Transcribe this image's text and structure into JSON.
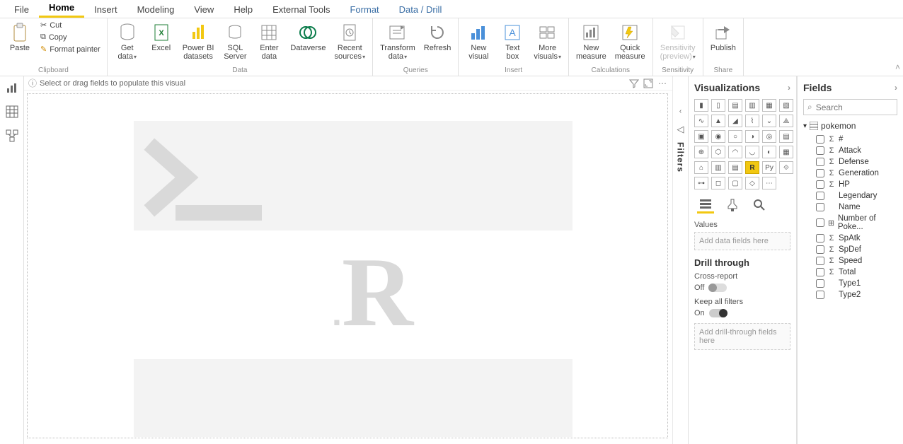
{
  "tabs": {
    "file": "File",
    "home": "Home",
    "insert": "Insert",
    "modeling": "Modeling",
    "view": "View",
    "help": "Help",
    "external": "External Tools",
    "format": "Format",
    "data_drill": "Data / Drill"
  },
  "ribbon": {
    "paste": "Paste",
    "cut": "Cut",
    "copy": "Copy",
    "format_painter": "Format painter",
    "clipboard": "Clipboard",
    "get_data": "Get\ndata",
    "excel": "Excel",
    "pbi_ds": "Power BI\ndatasets",
    "sql": "SQL\nServer",
    "enter": "Enter\ndata",
    "dataverse": "Dataverse",
    "recent": "Recent\nsources",
    "data_group": "Data",
    "transform": "Transform\ndata",
    "refresh": "Refresh",
    "queries": "Queries",
    "new_visual": "New\nvisual",
    "text_box": "Text\nbox",
    "more_visuals": "More\nvisuals",
    "insert_group": "Insert",
    "new_measure": "New\nmeasure",
    "quick_measure": "Quick\nmeasure",
    "calc_group": "Calculations",
    "sensitivity": "Sensitivity\n(preview)",
    "sensitivity_group": "Sensitivity",
    "publish": "Publish",
    "share_group": "Share"
  },
  "canvas": {
    "hint": "Select or drag fields to populate this visual"
  },
  "filters": {
    "label": "Filters"
  },
  "viz": {
    "title": "Visualizations",
    "values": "Values",
    "values_hint": "Add data fields here",
    "drill": "Drill through",
    "cross": "Cross-report",
    "off": "Off",
    "keep": "Keep all filters",
    "on": "On",
    "drill_hint": "Add drill-through fields here"
  },
  "fields": {
    "title": "Fields",
    "search_ph": "Search",
    "table": "pokemon",
    "items": [
      {
        "name": "#",
        "sigma": true
      },
      {
        "name": "Attack",
        "sigma": true
      },
      {
        "name": "Defense",
        "sigma": true
      },
      {
        "name": "Generation",
        "sigma": true
      },
      {
        "name": "HP",
        "sigma": true
      },
      {
        "name": "Legendary",
        "sigma": false
      },
      {
        "name": "Name",
        "sigma": false
      },
      {
        "name": "Number of Poke...",
        "sigma": false,
        "hier": true
      },
      {
        "name": "SpAtk",
        "sigma": true
      },
      {
        "name": "SpDef",
        "sigma": true
      },
      {
        "name": "Speed",
        "sigma": true
      },
      {
        "name": "Total",
        "sigma": true
      },
      {
        "name": "Type1",
        "sigma": false
      },
      {
        "name": "Type2",
        "sigma": false
      }
    ]
  }
}
